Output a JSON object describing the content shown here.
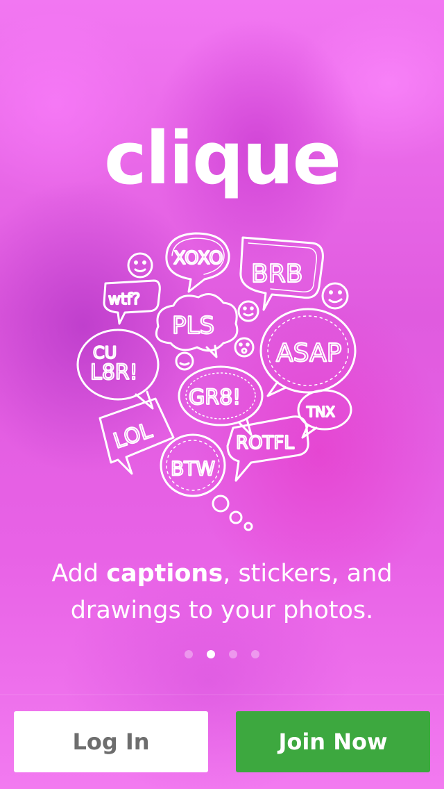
{
  "app": {
    "logo_text": "clique"
  },
  "illustration": {
    "bubble_words": [
      "XOXO",
      "BRB",
      "wtf?",
      "PLS",
      "ASAP",
      "CU",
      "L8R!",
      "GR8!",
      "LOL",
      "TNX",
      "ROTFL",
      "BTW"
    ]
  },
  "caption": {
    "prefix": "Add ",
    "bold": "captions",
    "rest": ", stickers, and drawings to your photos."
  },
  "pager": {
    "count": 4,
    "active_index": 1
  },
  "buttons": {
    "login_label": "Log In",
    "join_label": "Join Now"
  },
  "colors": {
    "background": "#e85ee6",
    "join_button": "#3da83f",
    "login_text": "#6d6d6d"
  }
}
